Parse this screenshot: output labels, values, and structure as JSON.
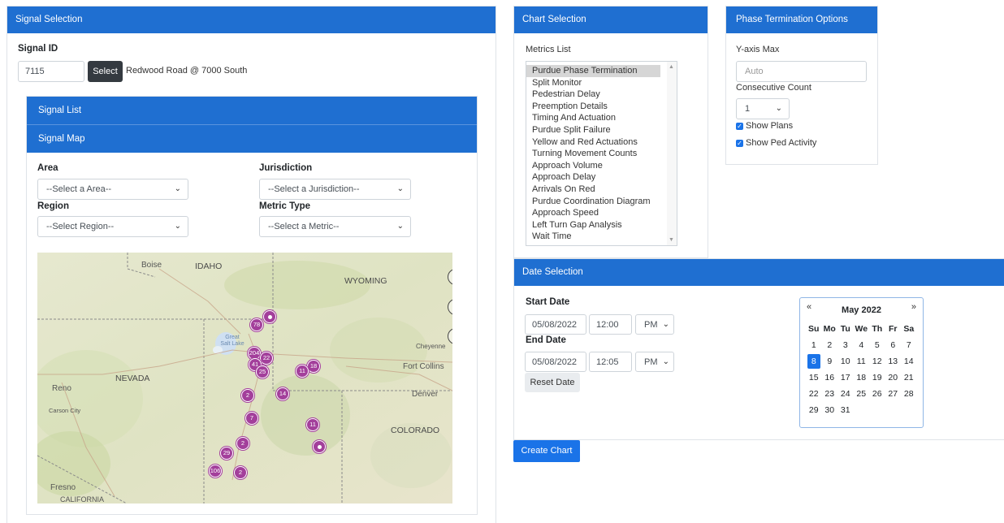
{
  "signal_selection": {
    "header": "Signal Selection",
    "signal_id_label": "Signal ID",
    "signal_id_value": "7115",
    "select_button": "Select",
    "signal_name": "Redwood Road @ 7000 South",
    "signal_list_header": "Signal List",
    "signal_map_header": "Signal Map",
    "area_label": "Area",
    "area_value": "--Select a Area--",
    "jurisdiction_label": "Jurisdiction",
    "jurisdiction_value": "--Select a Jurisdiction--",
    "region_label": "Region",
    "region_value": "--Select Region--",
    "metric_type_label": "Metric Type",
    "metric_type_value": "--Select a Metric--"
  },
  "map": {
    "labels": {
      "boise": "Boise",
      "idaho": "IDAHO",
      "wyoming": "WYOMING",
      "great_salt_lake": "Great Salt Lake",
      "cheyenne": "Cheyenne",
      "nevada": "NEVADA",
      "fort_collins": "Fort Collins",
      "reno": "Reno",
      "denver": "Denver",
      "carson_city": "Carson City",
      "colorado": "COLORADO",
      "fresno": "Fresno",
      "california": "CALIFORNIA"
    },
    "markers": [
      "78",
      "",
      "204",
      "22",
      "41",
      "25",
      "18",
      "11",
      "2",
      "14",
      "7",
      "11",
      "2",
      "29",
      "",
      "106",
      "2"
    ],
    "colors": {
      "marker": "#a33f9b"
    }
  },
  "chart_selection": {
    "header": "Chart Selection",
    "metrics_label": "Metrics List",
    "metrics": [
      "Purdue Phase Termination",
      "Split Monitor",
      "Pedestrian Delay",
      "Preemption Details",
      "Timing And Actuation",
      "Purdue Split Failure",
      "Yellow and Red Actuations",
      "Turning Movement Counts",
      "Approach Volume",
      "Approach Delay",
      "Arrivals On Red",
      "Purdue Coordination Diagram",
      "Approach Speed",
      "Left Turn Gap Analysis",
      "Wait Time"
    ]
  },
  "phase_termination": {
    "header": "Phase Termination Options",
    "y_axis_label": "Y-axis Max",
    "y_axis_placeholder": "Auto",
    "consecutive_label": "Consecutive Count",
    "consecutive_value": "1",
    "show_plans": "Show Plans",
    "show_ped": "Show Ped Activity"
  },
  "date_selection": {
    "header": "Date Selection",
    "start_label": "Start Date",
    "start_date": "05/08/2022",
    "start_time": "12:00",
    "start_ampm": "PM",
    "end_label": "End Date",
    "end_date": "05/08/2022",
    "end_time": "12:05",
    "end_ampm": "PM",
    "reset_button": "Reset Date"
  },
  "calendar": {
    "prev": "«",
    "next": "»",
    "month": "May 2022",
    "weekdays": [
      "Su",
      "Mo",
      "Tu",
      "We",
      "Th",
      "Fr",
      "Sa"
    ],
    "weeks": [
      [
        "1",
        "2",
        "3",
        "4",
        "5",
        "6",
        "7"
      ],
      [
        "8",
        "9",
        "10",
        "11",
        "12",
        "13",
        "14"
      ],
      [
        "15",
        "16",
        "17",
        "18",
        "19",
        "20",
        "21"
      ],
      [
        "22",
        "23",
        "24",
        "25",
        "26",
        "27",
        "28"
      ],
      [
        "29",
        "30",
        "31",
        "",
        "",
        "",
        ""
      ]
    ],
    "selected_day": "8"
  },
  "create_chart_button": "Create Chart",
  "colors": {
    "header_blue": "#1f6fd1",
    "button_blue": "#1a73e8",
    "dark_button": "#343a40"
  }
}
